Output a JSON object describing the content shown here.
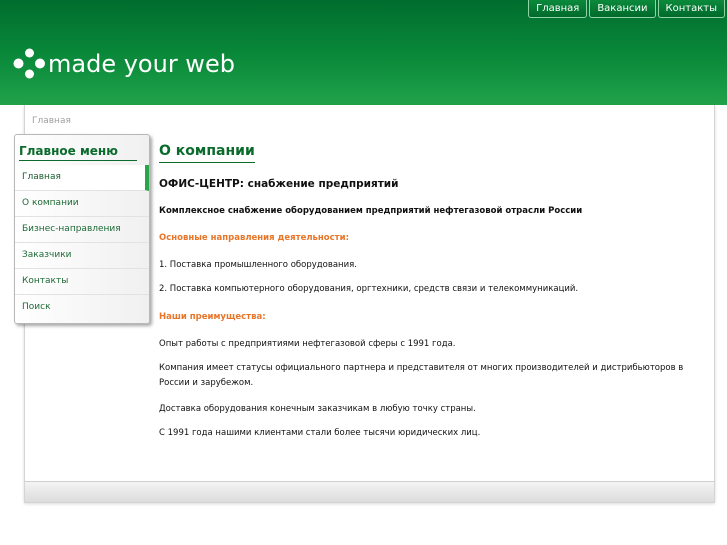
{
  "topnav": {
    "items": [
      "Главная",
      "Вакансии",
      "Контакты"
    ]
  },
  "logo": {
    "text": "made your web"
  },
  "breadcrumb": "Главная",
  "sidebar": {
    "title": "Главное меню",
    "items": [
      "Главная",
      "О компании",
      "Бизнес-направления",
      "Заказчики",
      "Контакты",
      "Поиск"
    ]
  },
  "content": {
    "title": "О компании",
    "subtitle": "ОФИС-ЦЕНТР: снабжение предприятий",
    "intro": "Комплексное снабжение оборудованием предприятий нефтегазовой отрасли России",
    "directions_heading": "Основные направления деятельности:",
    "direction_1": "1. Поставка промышленного оборудования.",
    "direction_2": "2. Поставка компьютерного оборудования, оргтехники, средств связи и телекоммуникаций.",
    "advantages_heading": "Наши преимущества:",
    "adv_1": "Опыт работы с предприятиями нефтегазовой сферы с 1991 года.",
    "adv_2": "Компания имеет статусы официального партнера и представителя от многих производителей и дистрибьюторов в России и зарубежом.",
    "adv_3": "Доставка оборудования конечным заказчикам в любую точку страны.",
    "adv_4": "С 1991 года нашими клиентами стали более тысячи юридических лиц."
  },
  "colors": {
    "header_green": "#0a8a3a",
    "title_green": "#0a6b2c",
    "accent_orange": "#e8762a"
  }
}
